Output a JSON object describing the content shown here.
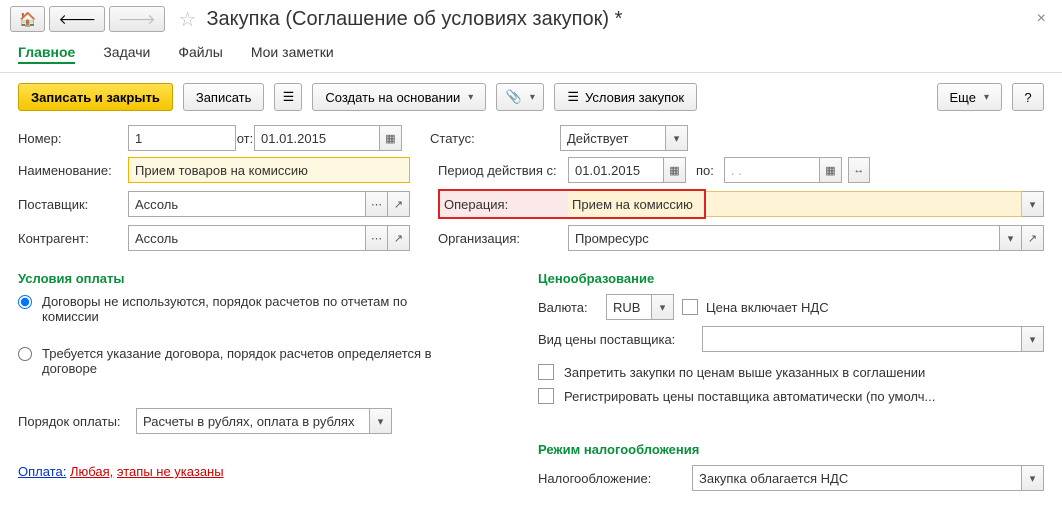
{
  "header": {
    "title": "Закупка (Соглашение об условиях закупок) *"
  },
  "tabs": [
    {
      "label": "Главное",
      "active": true
    },
    {
      "label": "Задачи",
      "active": false
    },
    {
      "label": "Файлы",
      "active": false
    },
    {
      "label": "Мои заметки",
      "active": false
    }
  ],
  "buttons": {
    "save_close": "Записать и закрыть",
    "save": "Записать",
    "create_based": "Создать на основании",
    "conditions": "Условия закупок",
    "more": "Еще",
    "help": "?"
  },
  "form": {
    "number_lbl": "Номер:",
    "number": "1",
    "from_lbl": "от:",
    "from_date": "01.01.2015",
    "status_lbl": "Статус:",
    "status": "Действует",
    "name_lbl": "Наименование:",
    "name": "Прием товаров на комиссию",
    "period_lbl": "Период действия с:",
    "period_from": "01.01.2015",
    "to_lbl": "по:",
    "period_to": ".  .",
    "supplier_lbl": "Поставщик:",
    "supplier": "Ассоль",
    "operation_lbl": "Операция:",
    "operation": "Прием на комиссию",
    "contragent_lbl": "Контрагент:",
    "contragent": "Ассоль",
    "org_lbl": "Организация:",
    "org": "Промресурс"
  },
  "payment": {
    "title": "Условия оплаты",
    "r1": "Договоры не используются, порядок расчетов по отчетам по комиссии",
    "r2": "Требуется указание договора, порядок расчетов определяется в договоре",
    "order_lbl": "Порядок оплаты:",
    "order": "Расчеты в рублях, оплата в рублях",
    "link_pay": "Оплата:",
    "link_any": "Любая,",
    "link_stages": "этапы не указаны"
  },
  "pricing": {
    "title": "Ценообразование",
    "currency_lbl": "Валюта:",
    "currency": "RUB",
    "vat_incl": "Цена включает НДС",
    "pricetype_lbl": "Вид цены поставщика:",
    "cb1": "Запретить закупки по ценам выше указанных в соглашении",
    "cb2": "Регистрировать цены поставщика автоматически (по умолч..."
  },
  "tax": {
    "title": "Режим налогообложения",
    "lbl": "Налогообложение:",
    "val": "Закупка облагается НДС"
  }
}
